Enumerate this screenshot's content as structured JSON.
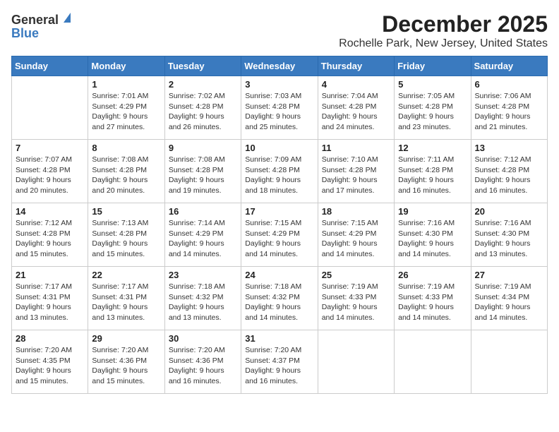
{
  "logo": {
    "general": "General",
    "blue": "Blue"
  },
  "title": "December 2025",
  "subtitle": "Rochelle Park, New Jersey, United States",
  "days_of_week": [
    "Sunday",
    "Monday",
    "Tuesday",
    "Wednesday",
    "Thursday",
    "Friday",
    "Saturday"
  ],
  "weeks": [
    [
      {
        "day": "",
        "sunrise": "",
        "sunset": "",
        "daylight": ""
      },
      {
        "day": "1",
        "sunrise": "Sunrise: 7:01 AM",
        "sunset": "Sunset: 4:29 PM",
        "daylight": "Daylight: 9 hours and 27 minutes."
      },
      {
        "day": "2",
        "sunrise": "Sunrise: 7:02 AM",
        "sunset": "Sunset: 4:28 PM",
        "daylight": "Daylight: 9 hours and 26 minutes."
      },
      {
        "day": "3",
        "sunrise": "Sunrise: 7:03 AM",
        "sunset": "Sunset: 4:28 PM",
        "daylight": "Daylight: 9 hours and 25 minutes."
      },
      {
        "day": "4",
        "sunrise": "Sunrise: 7:04 AM",
        "sunset": "Sunset: 4:28 PM",
        "daylight": "Daylight: 9 hours and 24 minutes."
      },
      {
        "day": "5",
        "sunrise": "Sunrise: 7:05 AM",
        "sunset": "Sunset: 4:28 PM",
        "daylight": "Daylight: 9 hours and 23 minutes."
      },
      {
        "day": "6",
        "sunrise": "Sunrise: 7:06 AM",
        "sunset": "Sunset: 4:28 PM",
        "daylight": "Daylight: 9 hours and 21 minutes."
      }
    ],
    [
      {
        "day": "7",
        "sunrise": "Sunrise: 7:07 AM",
        "sunset": "Sunset: 4:28 PM",
        "daylight": "Daylight: 9 hours and 20 minutes."
      },
      {
        "day": "8",
        "sunrise": "Sunrise: 7:08 AM",
        "sunset": "Sunset: 4:28 PM",
        "daylight": "Daylight: 9 hours and 20 minutes."
      },
      {
        "day": "9",
        "sunrise": "Sunrise: 7:08 AM",
        "sunset": "Sunset: 4:28 PM",
        "daylight": "Daylight: 9 hours and 19 minutes."
      },
      {
        "day": "10",
        "sunrise": "Sunrise: 7:09 AM",
        "sunset": "Sunset: 4:28 PM",
        "daylight": "Daylight: 9 hours and 18 minutes."
      },
      {
        "day": "11",
        "sunrise": "Sunrise: 7:10 AM",
        "sunset": "Sunset: 4:28 PM",
        "daylight": "Daylight: 9 hours and 17 minutes."
      },
      {
        "day": "12",
        "sunrise": "Sunrise: 7:11 AM",
        "sunset": "Sunset: 4:28 PM",
        "daylight": "Daylight: 9 hours and 16 minutes."
      },
      {
        "day": "13",
        "sunrise": "Sunrise: 7:12 AM",
        "sunset": "Sunset: 4:28 PM",
        "daylight": "Daylight: 9 hours and 16 minutes."
      }
    ],
    [
      {
        "day": "14",
        "sunrise": "Sunrise: 7:12 AM",
        "sunset": "Sunset: 4:28 PM",
        "daylight": "Daylight: 9 hours and 15 minutes."
      },
      {
        "day": "15",
        "sunrise": "Sunrise: 7:13 AM",
        "sunset": "Sunset: 4:28 PM",
        "daylight": "Daylight: 9 hours and 15 minutes."
      },
      {
        "day": "16",
        "sunrise": "Sunrise: 7:14 AM",
        "sunset": "Sunset: 4:29 PM",
        "daylight": "Daylight: 9 hours and 14 minutes."
      },
      {
        "day": "17",
        "sunrise": "Sunrise: 7:15 AM",
        "sunset": "Sunset: 4:29 PM",
        "daylight": "Daylight: 9 hours and 14 minutes."
      },
      {
        "day": "18",
        "sunrise": "Sunrise: 7:15 AM",
        "sunset": "Sunset: 4:29 PM",
        "daylight": "Daylight: 9 hours and 14 minutes."
      },
      {
        "day": "19",
        "sunrise": "Sunrise: 7:16 AM",
        "sunset": "Sunset: 4:30 PM",
        "daylight": "Daylight: 9 hours and 14 minutes."
      },
      {
        "day": "20",
        "sunrise": "Sunrise: 7:16 AM",
        "sunset": "Sunset: 4:30 PM",
        "daylight": "Daylight: 9 hours and 13 minutes."
      }
    ],
    [
      {
        "day": "21",
        "sunrise": "Sunrise: 7:17 AM",
        "sunset": "Sunset: 4:31 PM",
        "daylight": "Daylight: 9 hours and 13 minutes."
      },
      {
        "day": "22",
        "sunrise": "Sunrise: 7:17 AM",
        "sunset": "Sunset: 4:31 PM",
        "daylight": "Daylight: 9 hours and 13 minutes."
      },
      {
        "day": "23",
        "sunrise": "Sunrise: 7:18 AM",
        "sunset": "Sunset: 4:32 PM",
        "daylight": "Daylight: 9 hours and 13 minutes."
      },
      {
        "day": "24",
        "sunrise": "Sunrise: 7:18 AM",
        "sunset": "Sunset: 4:32 PM",
        "daylight": "Daylight: 9 hours and 14 minutes."
      },
      {
        "day": "25",
        "sunrise": "Sunrise: 7:19 AM",
        "sunset": "Sunset: 4:33 PM",
        "daylight": "Daylight: 9 hours and 14 minutes."
      },
      {
        "day": "26",
        "sunrise": "Sunrise: 7:19 AM",
        "sunset": "Sunset: 4:33 PM",
        "daylight": "Daylight: 9 hours and 14 minutes."
      },
      {
        "day": "27",
        "sunrise": "Sunrise: 7:19 AM",
        "sunset": "Sunset: 4:34 PM",
        "daylight": "Daylight: 9 hours and 14 minutes."
      }
    ],
    [
      {
        "day": "28",
        "sunrise": "Sunrise: 7:20 AM",
        "sunset": "Sunset: 4:35 PM",
        "daylight": "Daylight: 9 hours and 15 minutes."
      },
      {
        "day": "29",
        "sunrise": "Sunrise: 7:20 AM",
        "sunset": "Sunset: 4:36 PM",
        "daylight": "Daylight: 9 hours and 15 minutes."
      },
      {
        "day": "30",
        "sunrise": "Sunrise: 7:20 AM",
        "sunset": "Sunset: 4:36 PM",
        "daylight": "Daylight: 9 hours and 16 minutes."
      },
      {
        "day": "31",
        "sunrise": "Sunrise: 7:20 AM",
        "sunset": "Sunset: 4:37 PM",
        "daylight": "Daylight: 9 hours and 16 minutes."
      },
      {
        "day": "",
        "sunrise": "",
        "sunset": "",
        "daylight": ""
      },
      {
        "day": "",
        "sunrise": "",
        "sunset": "",
        "daylight": ""
      },
      {
        "day": "",
        "sunrise": "",
        "sunset": "",
        "daylight": ""
      }
    ]
  ]
}
